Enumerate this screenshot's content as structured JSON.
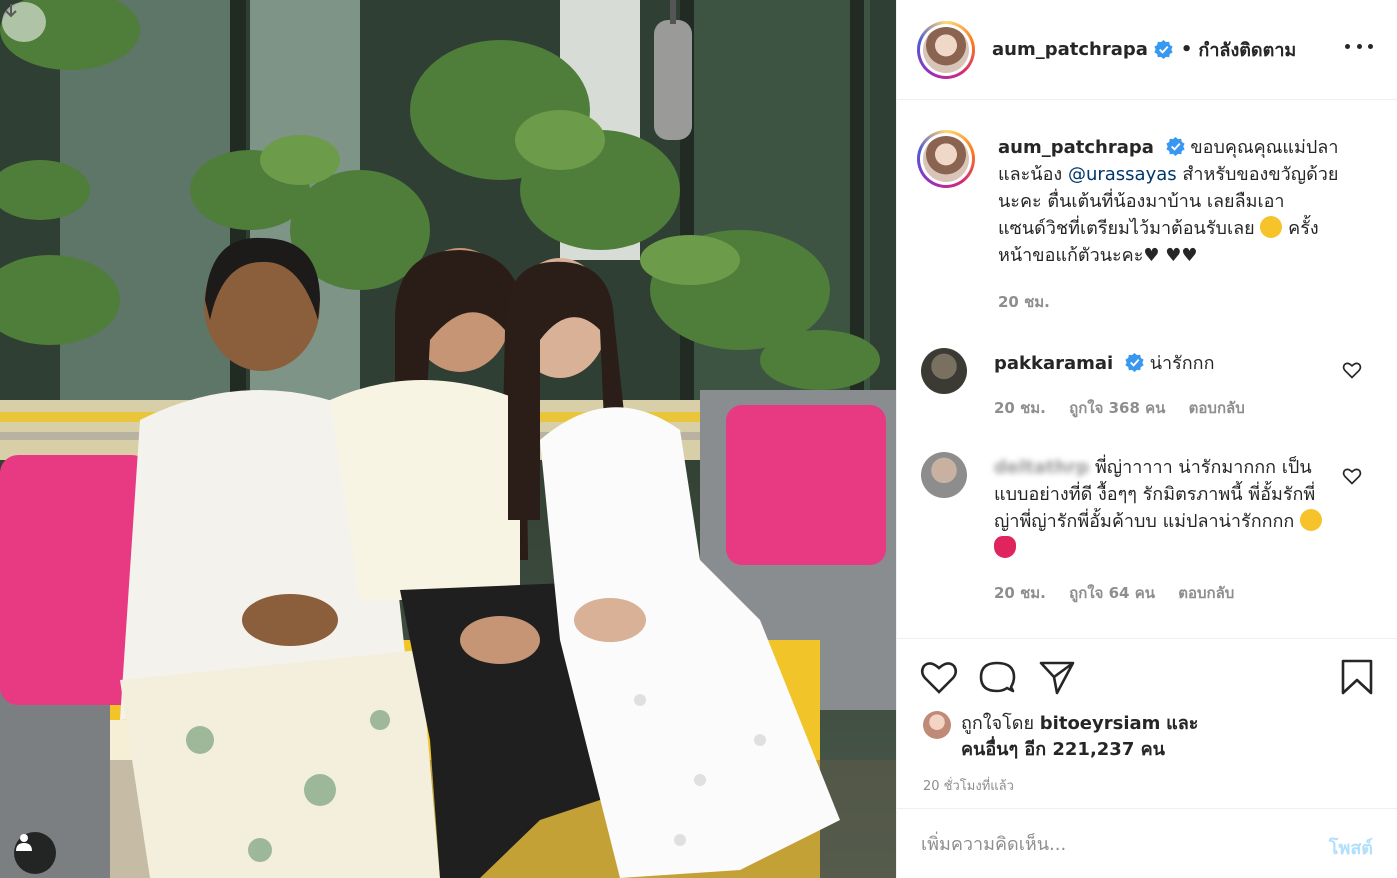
{
  "header": {
    "username": "aum_patchrapa",
    "dot": "•",
    "follow_status": "กำลังติดตาม"
  },
  "caption": {
    "username": "aum_patchrapa",
    "text_before_mention": "ขอบคุณคุณแม่ปลาและน้อง",
    "mention": "@urassayas",
    "text_after_mention": "สำหรับของขวัญด้วยนะคะ ตื่นเต้นที่น้องมาบ้าน เลยลืมเอาแซนด์วิชที่เตรียมไว้มาต้อนรับเลย",
    "text_end": "ครั้งหน้าขอแก้ตัวนะคะ♥ ♥♥",
    "time": "20 ชม."
  },
  "comments": [
    {
      "username": "pakkaramai",
      "text": "น่ารักกก",
      "time": "20 ชม.",
      "likes": "ถูกใจ 368 คน",
      "reply": "ตอบกลับ"
    },
    {
      "username": "deltathrp",
      "text": "พี่ญ่าาาาา น่ารักมากกก เป็นแบบอย่างที่ดี งื้อๆๆ รักมิตรภาพนี้ พี่อั้มรักพี่ญ่าพี่ญ่ารักพี่อั้มค้าบบ แม่ปลาน่ารักกกก",
      "time": "20 ชม.",
      "likes": "ถูกใจ 64 คน",
      "reply": "ตอบกลับ"
    }
  ],
  "likes": {
    "prefix": "ถูกใจโดย",
    "by_user": "bitoeyrsiam",
    "and": "และ",
    "others": "คนอื่นๆ อีก 221,237 คน"
  },
  "time_ago": "20 ชั่วโมงที่แล้ว",
  "add_comment": {
    "placeholder": "เพิ่มความคิดเห็น...",
    "post_label": "โพสต์"
  },
  "icons": {
    "more": "more-options-icon",
    "like": "heart-icon",
    "comment": "comment-icon",
    "share": "paper-plane-icon",
    "save": "bookmark-icon",
    "verified": "verified-badge-icon",
    "user_tag": "user-tag-icon"
  },
  "colors": {
    "verified": "#3897f0",
    "mention": "#00376b",
    "muted": "#8e8e8e",
    "post_button": "#b2dffc"
  }
}
